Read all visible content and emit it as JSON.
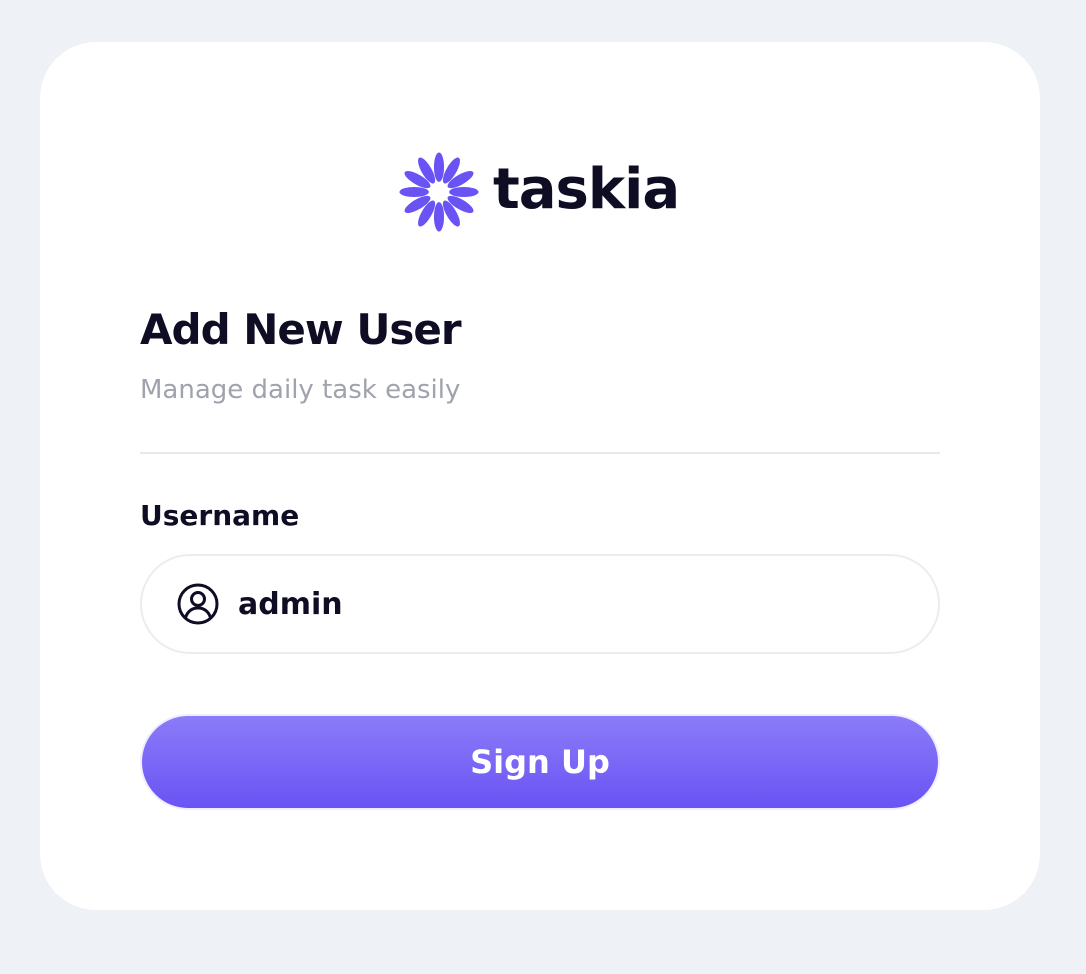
{
  "brand": {
    "name": "taskia",
    "logo_icon": "flower-icon",
    "accent_color": "#6a53f4"
  },
  "form": {
    "title": "Add New User",
    "subtitle": "Manage daily task easily",
    "username": {
      "label": "Username",
      "value": "admin",
      "icon": "user-circle-icon"
    },
    "submit_label": "Sign Up"
  },
  "colors": {
    "background": "#eef1f5",
    "card": "#ffffff",
    "text_primary": "#0e0d23",
    "text_muted": "#a0a3ad",
    "button_gradient_top": "#8b7cf8",
    "button_gradient_bottom": "#6a53f4"
  }
}
